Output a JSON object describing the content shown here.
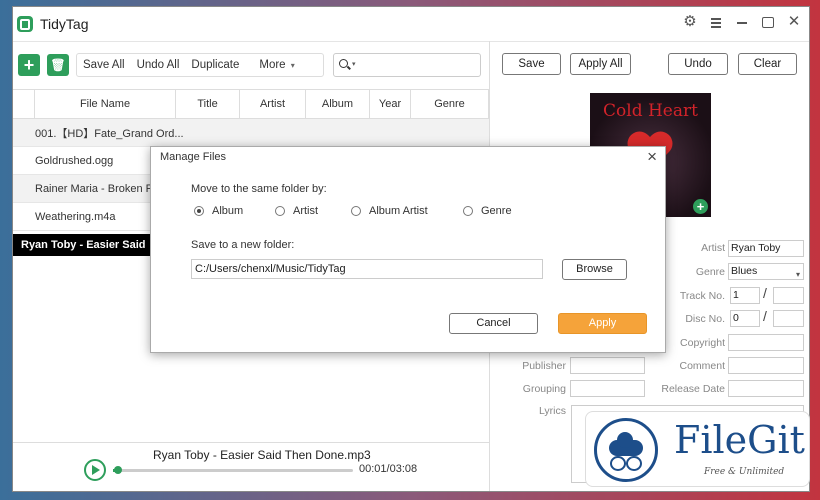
{
  "app": {
    "title": "TidyTag"
  },
  "toolbar": {
    "save_all": "Save All",
    "undo_all": "Undo All",
    "duplicate": "Duplicate",
    "more": "More"
  },
  "table": {
    "columns": [
      "File Name",
      "Title",
      "Artist",
      "Album",
      "Year",
      "Genre"
    ],
    "rows": [
      "001.【HD】Fate_Grand Ord...",
      "Goldrushed.ogg",
      "Rainer Maria - Broken R",
      "Weathering.m4a",
      "Ryan Toby - Easier Said"
    ]
  },
  "player": {
    "now_playing": "Ryan Toby - Easier Said Then Done.mp3",
    "time": "00:01/03:08",
    "progress": 0.02
  },
  "right": {
    "save": "Save",
    "apply_all": "Apply All",
    "undo": "Undo",
    "clear": "Clear",
    "cover_title": "Cold Heart",
    "fields": {
      "artist_label": "Artist",
      "artist_value": "Ryan Toby",
      "genre_label": "Genre",
      "genre_value": "Blues",
      "track_label": "Track No.",
      "track_value": "1",
      "disc_label": "Disc No.",
      "disc_value": "0",
      "copyright_label": "Copyright",
      "publisher_label": "Publisher",
      "comment_label": "Comment",
      "grouping_label": "Grouping",
      "release_label": "Release Date",
      "lyrics_label": "Lyrics"
    }
  },
  "dialog": {
    "title": "Manage Files",
    "move_label": "Move to the same folder by:",
    "options": [
      "Album",
      "Artist",
      "Album Artist",
      "Genre"
    ],
    "selected": "Album",
    "save_label": "Save to a new folder:",
    "path": "C:/Users/chenxl/Music/TidyTag",
    "browse": "Browse",
    "cancel": "Cancel",
    "apply": "Apply"
  },
  "watermark": {
    "name": "FileGit",
    "tagline": "Free & Unlimited"
  },
  "colors": {
    "accent": "#2e9e5b",
    "apply_button": "#f5a33a",
    "watermark": "#1d4e8a"
  }
}
